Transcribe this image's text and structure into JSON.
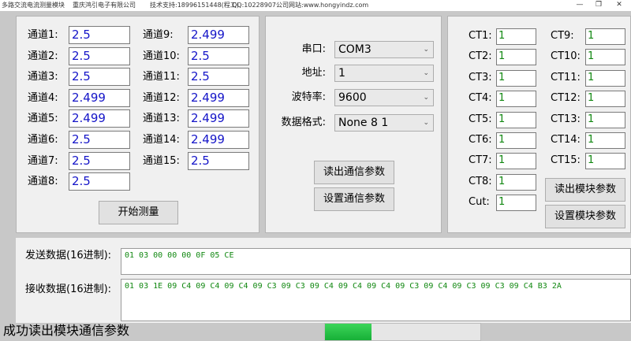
{
  "titlebar": {
    "app": "多路交流电流测量模块",
    "company": "重庆鸿引电子有限公司",
    "support": "技术支持:18996151448(程工)",
    "qq": "QQ:10228907",
    "website": "公司网站:www.hongyindz.com",
    "minimize": "—",
    "restore": "❐",
    "close": "✕"
  },
  "channels_left": [
    {
      "label": "通道1:",
      "value": "2.5"
    },
    {
      "label": "通道2:",
      "value": "2.5"
    },
    {
      "label": "通道3:",
      "value": "2.5"
    },
    {
      "label": "通道4:",
      "value": "2.499"
    },
    {
      "label": "通道5:",
      "value": "2.499"
    },
    {
      "label": "通道6:",
      "value": "2.5"
    },
    {
      "label": "通道7:",
      "value": "2.5"
    },
    {
      "label": "通道8:",
      "value": "2.5"
    }
  ],
  "channels_right": [
    {
      "label": "通道9:",
      "value": "2.499"
    },
    {
      "label": "通道10:",
      "value": "2.5"
    },
    {
      "label": "通道11:",
      "value": "2.5"
    },
    {
      "label": "通道12:",
      "value": "2.499"
    },
    {
      "label": "通道13:",
      "value": "2.499"
    },
    {
      "label": "通道14:",
      "value": "2.499"
    },
    {
      "label": "通道15:",
      "value": "2.5"
    }
  ],
  "start_button": "开始测量",
  "comm": {
    "port_label": "串口:",
    "port_value": "COM3",
    "addr_label": "地址:",
    "addr_value": "1",
    "baud_label": "波特率:",
    "baud_value": "9600",
    "format_label": "数据格式:",
    "format_value": "None 8 1",
    "read_button": "读出通信参数",
    "set_button": "设置通信参数",
    "arrow": "⌄"
  },
  "ct_left": [
    {
      "label": "CT1:",
      "value": "1"
    },
    {
      "label": "CT2:",
      "value": "1"
    },
    {
      "label": "CT3:",
      "value": "1"
    },
    {
      "label": "CT4:",
      "value": "1"
    },
    {
      "label": "CT5:",
      "value": "1"
    },
    {
      "label": "CT6:",
      "value": "1"
    },
    {
      "label": "CT7:",
      "value": "1"
    },
    {
      "label": "CT8:",
      "value": "1"
    },
    {
      "label": "Cut:",
      "value": "1"
    }
  ],
  "ct_right": [
    {
      "label": "CT9:",
      "value": "1"
    },
    {
      "label": "CT10:",
      "value": "1"
    },
    {
      "label": "CT11:",
      "value": "1"
    },
    {
      "label": "CT12:",
      "value": "1"
    },
    {
      "label": "CT13:",
      "value": "1"
    },
    {
      "label": "CT14:",
      "value": "1"
    },
    {
      "label": "CT15:",
      "value": "1"
    }
  ],
  "module": {
    "read_button": "读出模块参数",
    "set_button": "设置模块参数"
  },
  "send": {
    "label": "发送数据(16进制):",
    "value": "01 03 00 00 00 0F 05 CE"
  },
  "recv": {
    "label": "接收数据(16进制):",
    "value": "01 03 1E 09 C4 09 C4 09 C4 09 C3 09 C3 09 C4 09 C4 09 C4 09 C3 09 C4 09 C3 09 C3 09 C4 B3 2A"
  },
  "status_text": "成功读出模块通信参数",
  "progress_fraction": 0.3,
  "colors": {
    "value_blue": "#1515c8",
    "hex_green": "#118811",
    "progress_green": "#17b037"
  }
}
